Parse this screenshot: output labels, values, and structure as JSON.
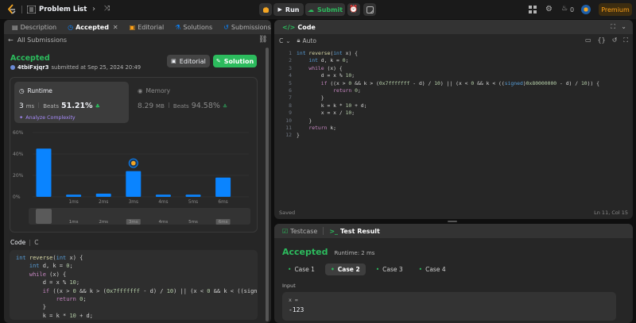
{
  "topbar": {
    "problem_list": "Problem List",
    "run": "Run",
    "submit": "Submit",
    "coins": "0",
    "premium": "Premium"
  },
  "left_tabs": [
    "Description",
    "Accepted",
    "Editorial",
    "Solutions",
    "Submissions"
  ],
  "submission": {
    "back": "All Submissions",
    "status": "Accepted",
    "user": "4tbiFxjqr3",
    "submitted_at": "submitted at Sep 25, 2024 20:49",
    "editorial_btn": "Editorial",
    "solution_btn": "Solution"
  },
  "runtime": {
    "label": "Runtime",
    "value": "3",
    "unit": "ms",
    "beats_label": "Beats",
    "beats": "51.21%",
    "analyze": "Analyze Complexity"
  },
  "memory": {
    "label": "Memory",
    "value": "8.29",
    "unit": "MB",
    "beats_label": "Beats",
    "beats": "94.58%"
  },
  "chart_data": {
    "type": "bar",
    "categories": [
      "",
      "1ms",
      "2ms",
      "3ms",
      "4ms",
      "5ms",
      "6ms"
    ],
    "values": [
      45,
      2,
      3,
      24,
      2,
      2,
      18
    ],
    "highlight_index": 3,
    "yticks": [
      "60%",
      "40%",
      "20%",
      "0%"
    ],
    "ylim": [
      0,
      60
    ],
    "mini_labels": [
      "",
      "1ms",
      "2ms",
      "3ms",
      "4ms",
      "5ms",
      "6ms"
    ]
  },
  "code_section": {
    "label": "Code",
    "lang": "C"
  },
  "left_code": [
    "int reverse(int x) {",
    "    int d, k = 0;",
    "    while (x) {",
    "        d = x % 10;",
    "        if ((x > 0 && k > (0x7fffffff - d) / 10) || (x < 0 && k < ((sign",
    "            return 0;",
    "        }",
    "        k = k * 10 + d;"
  ],
  "editor": {
    "title": "Code",
    "lang": "C",
    "mode": "Auto",
    "saved": "Saved",
    "cursor": "Ln 11, Col 15",
    "line_numbers": [
      "1",
      "2",
      "3",
      "4",
      "5",
      "6",
      "7",
      "8",
      "9",
      "10",
      "11",
      "12"
    ],
    "lines": [
      "int reverse(int x) {",
      "    int d, k = 0;",
      "    while (x) {",
      "        d = x % 10;",
      "        if ((x > 0 && k > (0x7fffffff - d) / 10) || (x < 0 && k < ((signed)0x80000000 - d) / 10)) {",
      "            return 0;",
      "        }",
      "        k = k * 10 + d;",
      "        x = x / 10;",
      "    }",
      "    return k;",
      "}"
    ]
  },
  "result": {
    "testcase_tab": "Testcase",
    "result_tab": "Test Result",
    "status": "Accepted",
    "runtime": "Runtime: 2 ms",
    "cases": [
      "Case 1",
      "Case 2",
      "Case 3",
      "Case 4"
    ],
    "input_label": "Input",
    "var_label": "x =",
    "var_value": "-123"
  },
  "colors": {
    "accent_green": "#2cbb5d",
    "bar_blue": "#0a84ff",
    "link_purple": "#a78bfa",
    "premium": "#ffa116"
  }
}
